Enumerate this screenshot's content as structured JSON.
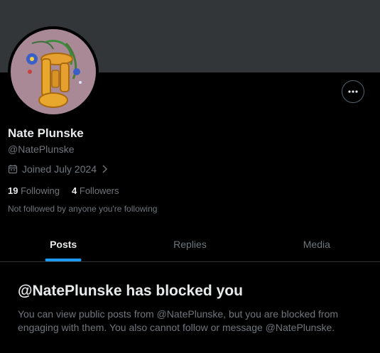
{
  "profile": {
    "display_name": "Nate Plunske",
    "handle": "@NatePlunske",
    "joined": "Joined July 2024",
    "following_count": "19",
    "following_label": "Following",
    "followers_count": "4",
    "followers_label": "Followers",
    "not_followed_text": "Not followed by anyone you're following"
  },
  "tabs": [
    {
      "label": "Posts",
      "active": true
    },
    {
      "label": "Replies",
      "active": false
    },
    {
      "label": "Media",
      "active": false
    }
  ],
  "blocked": {
    "title": "@NatePlunske has blocked you",
    "body": "You can view public posts from @NatePlunske, but you are blocked from engaging with them. You also cannot follow or message @NatePlunske."
  },
  "icons": {
    "more": "more-horizontal-icon",
    "calendar": "calendar-icon",
    "chevron": "chevron-right-icon"
  },
  "colors": {
    "accent": "#1d9bf0",
    "banner": "#333639",
    "muted_text": "#71767b",
    "primary_text": "#e7e9ea"
  }
}
